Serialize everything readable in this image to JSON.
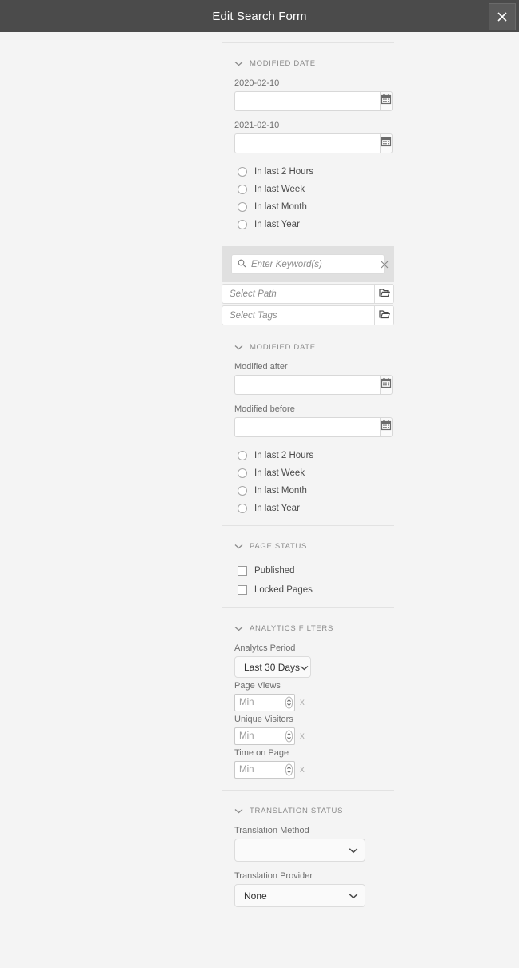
{
  "header": {
    "title": "Edit Search Form",
    "close_icon": "close-icon"
  },
  "sections": {
    "modified_date_top": {
      "title": "Modified Date",
      "date_fields": [
        {
          "label": "2020-02-10",
          "value": "",
          "icon": "calendar-icon"
        },
        {
          "label": "2021-02-10",
          "value": "",
          "icon": "calendar-icon"
        }
      ],
      "radios": [
        {
          "label": "In last 2 Hours",
          "selected": false
        },
        {
          "label": "In last Week",
          "selected": false
        },
        {
          "label": "In last Month",
          "selected": false
        },
        {
          "label": "In last Year",
          "selected": false
        }
      ]
    },
    "keyword": {
      "placeholder": "Enter Keyword(s)",
      "value": "",
      "search_icon": "search-icon",
      "clear_icon": "clear-icon"
    },
    "pickers": [
      {
        "placeholder": "Select Path",
        "icon": "folder-icon"
      },
      {
        "placeholder": "Select Tags",
        "icon": "folder-icon"
      }
    ],
    "modified_date_bottom": {
      "title": "Modified Date",
      "date_fields": [
        {
          "label": "Modified after",
          "value": "",
          "icon": "calendar-icon"
        },
        {
          "label": "Modified before",
          "value": "",
          "icon": "calendar-icon"
        }
      ],
      "radios": [
        {
          "label": "In last 2 Hours",
          "selected": false
        },
        {
          "label": "In last Week",
          "selected": false
        },
        {
          "label": "In last Month",
          "selected": false
        },
        {
          "label": "In last Year",
          "selected": false
        }
      ]
    },
    "page_status": {
      "title": "Page Status",
      "checkboxes": [
        {
          "label": "Published",
          "checked": false
        },
        {
          "label": "Locked Pages",
          "checked": false
        }
      ]
    },
    "analytics_filters": {
      "title": "Analytics Filters",
      "period": {
        "label": "Analytcs Period",
        "value": "Last 30 Days"
      },
      "metrics": [
        {
          "label": "Page Views",
          "placeholder": "Min",
          "value": "",
          "suffix": "x"
        },
        {
          "label": "Unique Visitors",
          "placeholder": "Min",
          "value": "",
          "suffix": "x"
        },
        {
          "label": "Time on Page",
          "placeholder": "Min",
          "value": "",
          "suffix": "x"
        }
      ]
    },
    "translation_status": {
      "title": "Translation Status",
      "method": {
        "label": "Translation Method",
        "value": ""
      },
      "provider": {
        "label": "Translation Provider",
        "value": "None"
      }
    }
  },
  "colors": {
    "titlebar_bg": "#4b4b4b",
    "page_bg": "#f4f4f4",
    "keyword_bg": "#e0e0e0",
    "divider": "#e2e2e2"
  }
}
